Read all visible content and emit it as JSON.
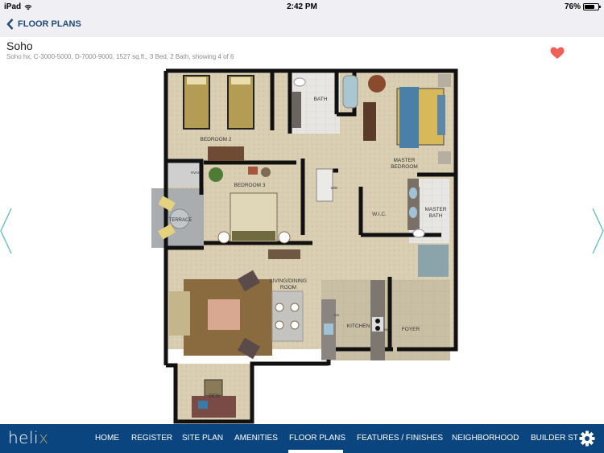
{
  "status_bar": {
    "device": "iPad",
    "time": "2:42 PM",
    "battery_percent": "76%",
    "battery_level": 0.76
  },
  "nav": {
    "back_label": "FLOOR PLANS"
  },
  "plan": {
    "title": "Soho",
    "subtitle": "Soho hx, C-3000-5000, D-7000-9000, 1527 sq.ft., 3 Bed, 2 Bath, showing 4 of 6",
    "favorite": true,
    "rooms": {
      "bedroom2": "BEDROOM 2",
      "bath": "BATH",
      "master_bedroom_1": "MASTER",
      "master_bedroom_2": "BEDROOM",
      "bedroom3": "BEDROOM 3",
      "hvac": "HVAC",
      "wd": "W/D",
      "terrace": "TERRACE",
      "wic": "W.I.C.",
      "master_bath_1": "MASTER",
      "master_bath_2": "BATH",
      "living_1": "LIVING/DINING",
      "living_2": "ROOM",
      "kitchen": "KITCHEN",
      "foyer": "FOYER",
      "den": "DEN",
      "dw": "DW",
      "mw": "MW"
    }
  },
  "tabbar": {
    "logo_main": "heli",
    "logo_accent": "x",
    "tabs": [
      {
        "label": "HOME"
      },
      {
        "label": "REGISTER"
      },
      {
        "label": "SITE PLAN"
      },
      {
        "label": "AMENITIES"
      },
      {
        "label": "FLOOR PLANS",
        "active": true
      },
      {
        "label": "FEATURES / FINISHES"
      },
      {
        "label": "NEIGHBORHOOD"
      },
      {
        "label": "BUILDER ST"
      }
    ]
  },
  "colors": {
    "accent": "#1f4b7c",
    "tabbar_bg": "#0b4580",
    "heart": "#f0605a",
    "arrow": "#5bbcb8"
  }
}
